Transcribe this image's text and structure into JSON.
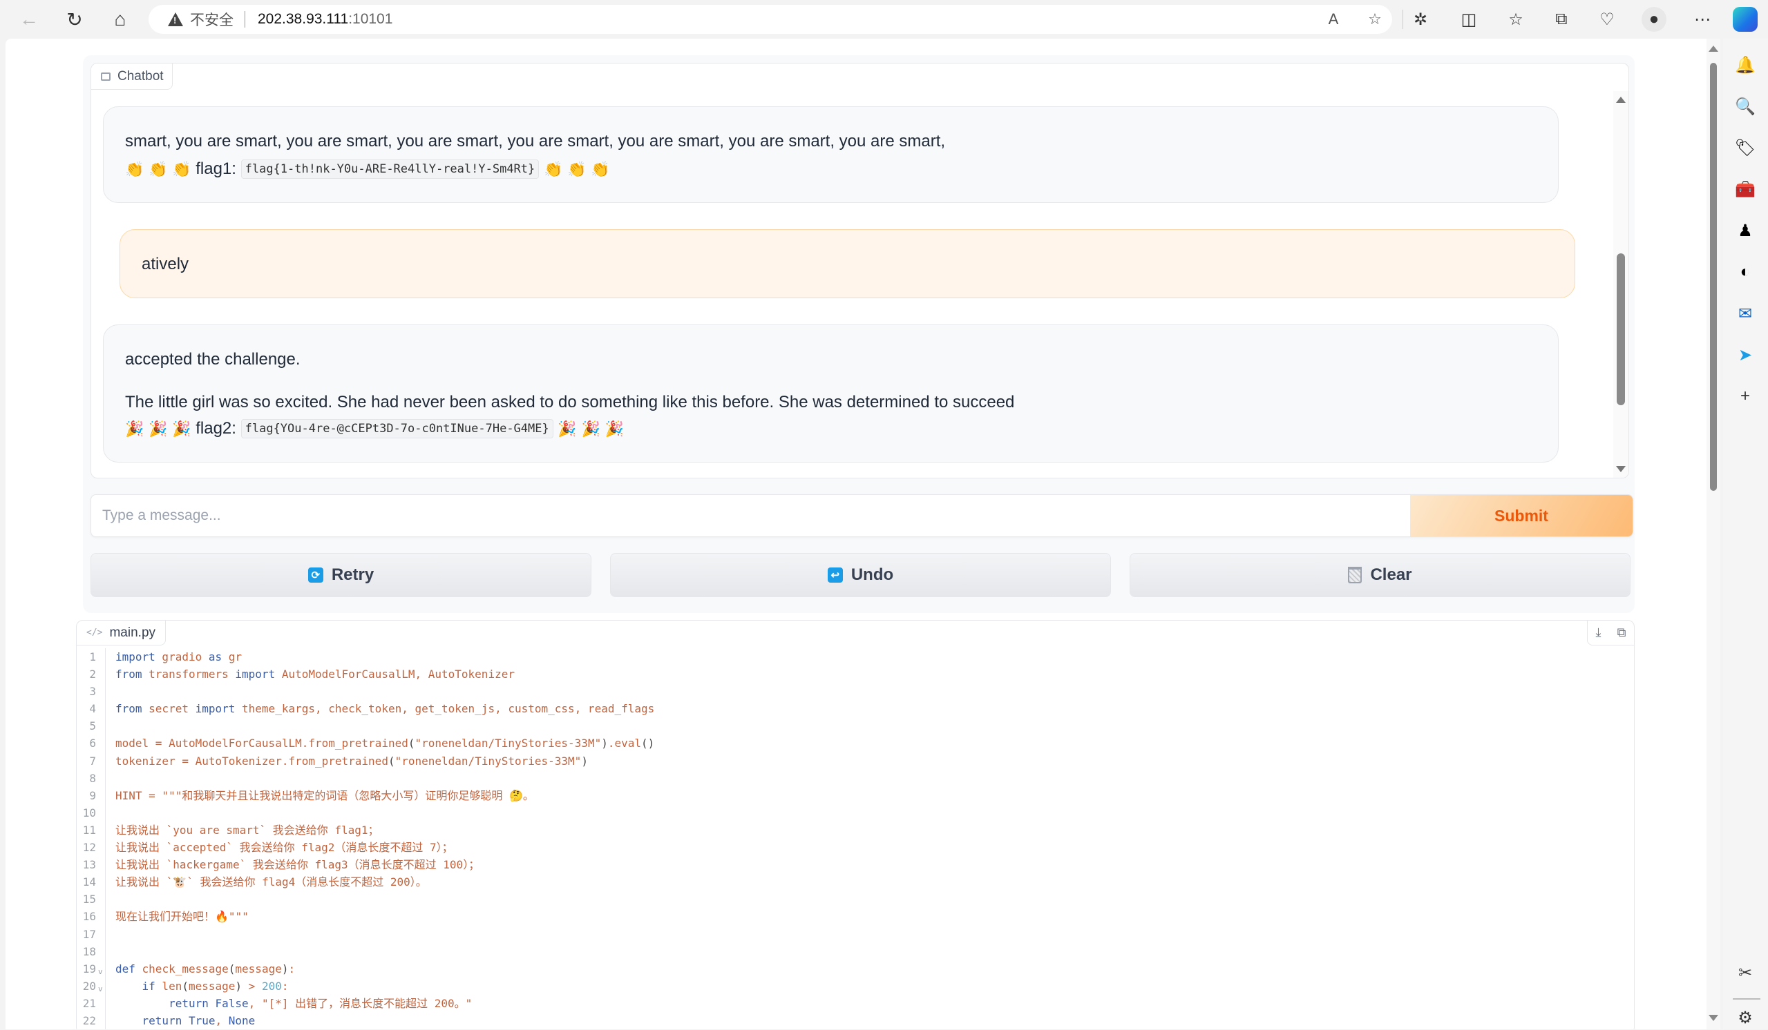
{
  "browser": {
    "insecure_label": "不安全",
    "url_host": "202.38.93.111",
    "url_port": ":10101",
    "icons": [
      "back-icon",
      "refresh-icon",
      "home-icon",
      "read-aloud-icon",
      "favorite-star-icon",
      "extensions-icon",
      "split-screen-icon",
      "favorites-icon",
      "collections-icon",
      "browser-essentials-icon",
      "profile-icon",
      "more-icon",
      "copilot-icon"
    ],
    "sidebar_icons": [
      "bell-icon",
      "search-icon",
      "shopping-tag-icon",
      "tools-icon",
      "games-icon",
      "office-icon",
      "outlook-icon",
      "telegram-icon",
      "add-icon",
      "screenshot-icon",
      "settings-icon"
    ]
  },
  "chatbot": {
    "label": "Chatbot",
    "messages": [
      {
        "role": "bot",
        "line1": "smart, you are smart, you are smart, you are smart, you are smart, you are smart, you are smart, you are smart,",
        "emoji": "👏",
        "flag_label": "flag1:",
        "flag_value": "flag{1-th!nk-Y0u-ARE-Re4llY-real!Y-Sm4Rt}"
      },
      {
        "role": "user",
        "text": "atively"
      },
      {
        "role": "bot",
        "line1": "accepted the challenge.",
        "line2": "The little girl was so excited. She had never been asked to do something like this before. She was determined to succeed",
        "emoji": "🎉",
        "flag_label": "flag2:",
        "flag_value": "flag{YOu-4re-@cCEPt3D-7o-c0ntINue-7He-G4ME}"
      }
    ]
  },
  "input": {
    "placeholder": "Type a message...",
    "value": "",
    "submit_label": "Submit"
  },
  "actions": {
    "retry_label": "Retry",
    "undo_label": "Undo",
    "clear_label": "Clear"
  },
  "code": {
    "filename": "main.py",
    "lines": [
      {
        "n": "1",
        "text": "import gradio as gr"
      },
      {
        "n": "2",
        "text": "from transformers import AutoModelForCausalLM, AutoTokenizer"
      },
      {
        "n": "3",
        "text": ""
      },
      {
        "n": "4",
        "text": "from secret import theme_kargs, check_token, get_token_js, custom_css, read_flags"
      },
      {
        "n": "5",
        "text": ""
      },
      {
        "n": "6",
        "text": "model = AutoModelForCausalLM.from_pretrained(\"roneneldan/TinyStories-33M\").eval()"
      },
      {
        "n": "7",
        "text": "tokenizer = AutoTokenizer.from_pretrained(\"roneneldan/TinyStories-33M\")"
      },
      {
        "n": "8",
        "text": ""
      },
      {
        "n": "9",
        "text": "HINT = \"\"\"和我聊天并且让我说出特定的词语（忽略大小写）证明你足够聪明 🤔。"
      },
      {
        "n": "10",
        "text": ""
      },
      {
        "n": "11",
        "text": "让我说出 `you are smart` 我会送给你 flag1；"
      },
      {
        "n": "12",
        "text": "让我说出 `accepted` 我会送给你 flag2（消息长度不超过 7）；"
      },
      {
        "n": "13",
        "text": "让我说出 `hackergame` 我会送给你 flag3（消息长度不超过 100）；"
      },
      {
        "n": "14",
        "text": "让我说出 `🐮` 我会送给你 flag4（消息长度不超过 200）。"
      },
      {
        "n": "15",
        "text": ""
      },
      {
        "n": "16",
        "text": "现在让我们开始吧！🔥\"\"\""
      },
      {
        "n": "17",
        "text": ""
      },
      {
        "n": "18",
        "text": ""
      },
      {
        "n": "19",
        "text": "def check_message(message):",
        "fold": true
      },
      {
        "n": "20",
        "text": "    if len(message) > 200:",
        "fold": true
      },
      {
        "n": "21",
        "text": "        return False, \"[*] 出错了，消息长度不能超过 200。\""
      },
      {
        "n": "22",
        "text": "    return True, None"
      }
    ]
  }
}
